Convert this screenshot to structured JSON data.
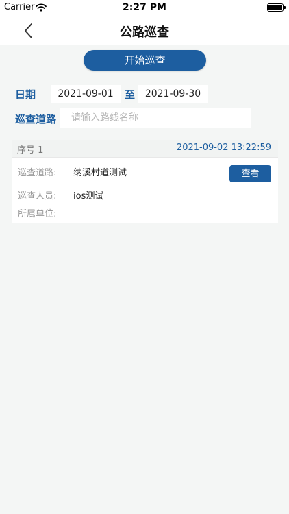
{
  "status_bar": {
    "carrier": "Carrier",
    "time": "2:27 PM"
  },
  "nav": {
    "title": "公路巡查"
  },
  "start_button": "开始巡查",
  "filters": {
    "date_label": "日期",
    "date_start": "2021-09-01",
    "to_label": "至",
    "date_end": "2021-09-30",
    "route_label": "巡查道路",
    "route_placeholder": "请输入路线名称"
  },
  "records": [
    {
      "seq": "序号 1",
      "timestamp": "2021-09-02 13:22:59",
      "route_label": "巡查道路:",
      "route_value": "纳溪村道测试",
      "inspector_label": "巡查人员:",
      "inspector_value": "ios测试",
      "unit_label": "所属单位:",
      "unit_value": "",
      "view_button": "查看"
    }
  ],
  "colors": {
    "accent": "#1d5ea0",
    "background": "#f4f6f5"
  }
}
